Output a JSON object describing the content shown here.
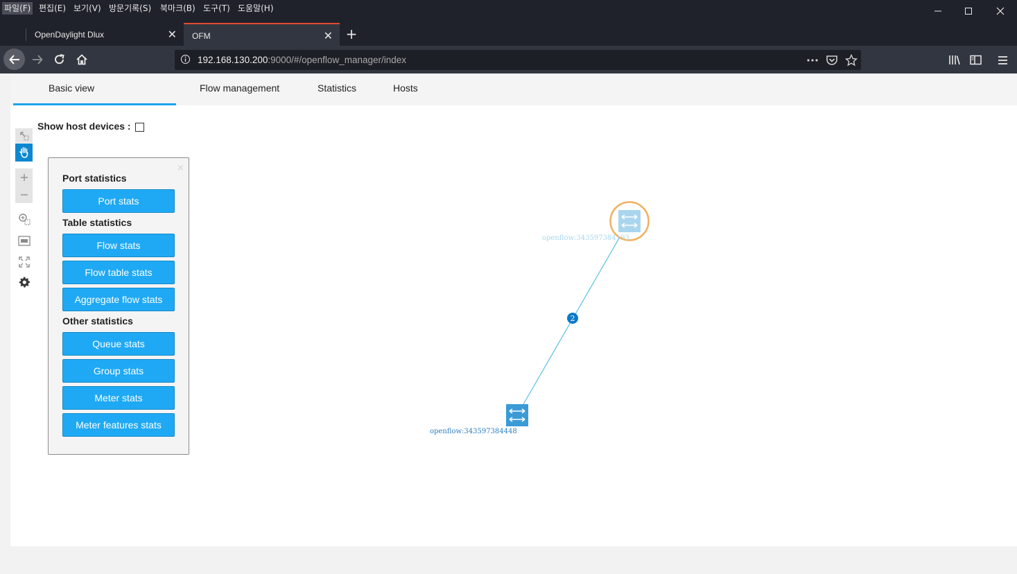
{
  "menu": [
    "파일(F)",
    "편집(E)",
    "보기(V)",
    "방문기록(S)",
    "북마크(B)",
    "도구(T)",
    "도움말(H)"
  ],
  "tabs": [
    {
      "label": "OpenDaylight Dlux"
    },
    {
      "label": "OFM"
    }
  ],
  "url": {
    "host": "192.168.130.200",
    "rest": ":9000/#/openflow_manager/index"
  },
  "app_tabs": [
    "Basic view",
    "Flow management",
    "Statistics",
    "Hosts"
  ],
  "show_host": {
    "label": "Show host devices :",
    "checked": false
  },
  "panel": {
    "close": "×",
    "sections": [
      {
        "title": "Port statistics",
        "buttons": [
          "Port stats"
        ]
      },
      {
        "title": "Table statistics",
        "buttons": [
          "Flow stats",
          "Flow table stats",
          "Aggregate flow stats"
        ]
      },
      {
        "title": "Other statistics",
        "buttons": [
          "Queue stats",
          "Group stats",
          "Meter stats",
          "Meter features stats"
        ]
      }
    ]
  },
  "topology": {
    "nodes": [
      {
        "label": "openflow:343597384193",
        "selected": true
      },
      {
        "label": "openflow:343597384448",
        "selected": false
      }
    ],
    "link_count": "2",
    "colors": {
      "link": "#5bbfe8",
      "node": "#3a9bd6",
      "selected_ring": "#f0b060",
      "badge": "#0b79c7"
    }
  }
}
